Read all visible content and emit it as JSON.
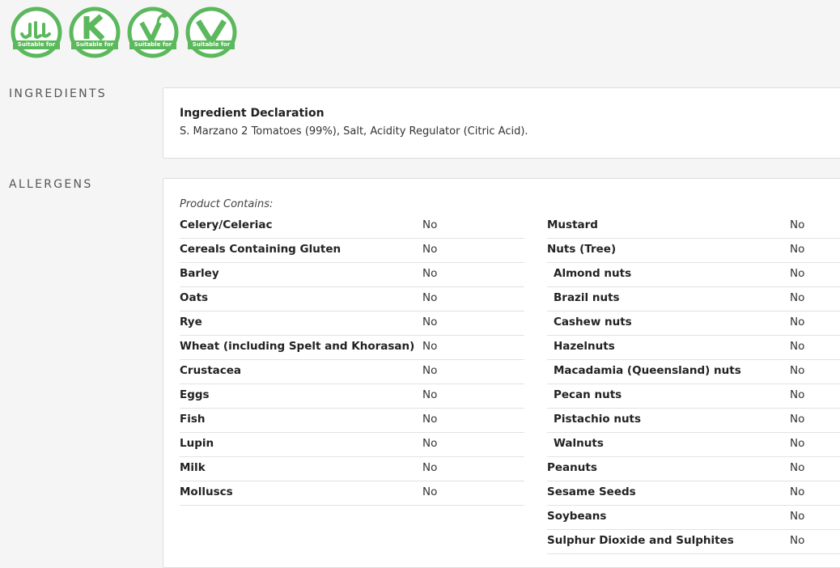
{
  "badges": [
    {
      "icon": "halal-icon",
      "caption": "Suitable for"
    },
    {
      "icon": "kosher-icon",
      "caption": "Suitable for"
    },
    {
      "icon": "vegetarian-icon",
      "caption": "Suitable for"
    },
    {
      "icon": "vegan-icon",
      "caption": "Suitable for"
    }
  ],
  "colors": {
    "badge_green": "#5cb85c",
    "panel_border": "#dddddd",
    "background": "#f5f5f5"
  },
  "ingredients": {
    "label": "INGREDIENTS",
    "title": "Ingredient Declaration",
    "text": "S. Marzano 2 Tomatoes (99%), Salt, Acidity Regulator (Citric Acid)."
  },
  "allergens": {
    "label": "ALLERGENS",
    "contains_label": "Product Contains:",
    "left": [
      {
        "name": "Celery/Celeriac",
        "value": "No"
      },
      {
        "name": "Cereals Containing Gluten",
        "value": "No"
      },
      {
        "name": "Barley",
        "value": "No"
      },
      {
        "name": "Oats",
        "value": "No"
      },
      {
        "name": "Rye",
        "value": "No"
      },
      {
        "name": "Wheat (including Spelt and Khorasan)",
        "value": "No"
      },
      {
        "name": "Crustacea",
        "value": "No"
      },
      {
        "name": "Eggs",
        "value": "No"
      },
      {
        "name": "Fish",
        "value": "No"
      },
      {
        "name": "Lupin",
        "value": "No"
      },
      {
        "name": "Milk",
        "value": "No"
      },
      {
        "name": "Molluscs",
        "value": "No"
      }
    ],
    "right": [
      {
        "name": "Mustard",
        "value": "No",
        "sub": false
      },
      {
        "name": "Nuts (Tree)",
        "value": "No",
        "sub": false
      },
      {
        "name": "Almond nuts",
        "value": "No",
        "sub": true
      },
      {
        "name": "Brazil nuts",
        "value": "No",
        "sub": true
      },
      {
        "name": "Cashew nuts",
        "value": "No",
        "sub": true
      },
      {
        "name": "Hazelnuts",
        "value": "No",
        "sub": true
      },
      {
        "name": "Macadamia (Queensland) nuts",
        "value": "No",
        "sub": true
      },
      {
        "name": "Pecan nuts",
        "value": "No",
        "sub": true
      },
      {
        "name": "Pistachio nuts",
        "value": "No",
        "sub": true
      },
      {
        "name": "Walnuts",
        "value": "No",
        "sub": true
      },
      {
        "name": "Peanuts",
        "value": "No",
        "sub": false
      },
      {
        "name": "Sesame Seeds",
        "value": "No",
        "sub": false
      },
      {
        "name": "Soybeans",
        "value": "No",
        "sub": false
      },
      {
        "name": "Sulphur Dioxide and Sulphites",
        "value": "No",
        "sub": false
      }
    ]
  }
}
